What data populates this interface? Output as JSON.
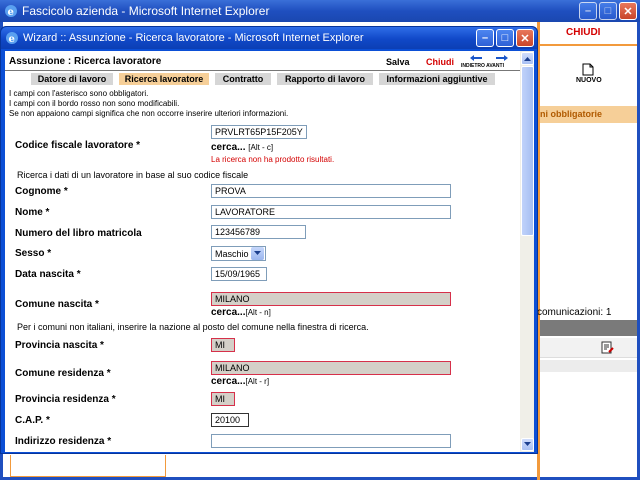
{
  "background_window": {
    "title": "Fascicolo azienda - Microsoft Internet Explorer",
    "chiudi": "CHIUDI",
    "nuovo": "NUOVO",
    "campi_obbligatorie": "ni obbligatorie",
    "comunicazioni": "comunicazioni: 1"
  },
  "popup": {
    "title": "Wizard :: Assunzione - Ricerca lavoratore - Microsoft Internet Explorer",
    "header_title": "Assunzione : Ricerca lavoratore",
    "salva": "Salva",
    "chiudi": "Chiudi",
    "nav_label": "INDIETRO AVANTI"
  },
  "tabs": [
    {
      "label": "Datore di lavoro",
      "active": false
    },
    {
      "label": "Ricerca lavoratore",
      "active": true
    },
    {
      "label": "Contratto",
      "active": false
    },
    {
      "label": "Rapporto di lavoro",
      "active": false
    },
    {
      "label": "Informazioni aggiuntive",
      "active": false
    }
  ],
  "notes": [
    "I campi con l'asterisco sono obbligatori.",
    "I campi con il bordo rosso non sono modificabili.",
    "Se non appaiono campi significa che non occorre inserire ulteriori informazioni."
  ],
  "form": {
    "codice_fiscale": {
      "label": "Codice fiscale lavoratore *",
      "value": "PRVLRT65P15F205Y",
      "cerca": "cerca...",
      "shortcut": "[Alt - c]",
      "error": "La ricerca non ha prodotto risultati."
    },
    "ricerca_info": "Ricerca i dati di un lavoratore in base al suo codice fiscale",
    "cognome": {
      "label": "Cognome *",
      "value": "PROVA"
    },
    "nome": {
      "label": "Nome *",
      "value": "LAVORATORE"
    },
    "matricola": {
      "label": "Numero del libro matricola",
      "value": "123456789"
    },
    "sesso": {
      "label": "Sesso *",
      "value": "Maschio"
    },
    "data_nascita": {
      "label": "Data nascita *",
      "value": "15/09/1965"
    },
    "comune_nascita": {
      "label": "Comune nascita *",
      "value": "MILANO",
      "cerca": "cerca...",
      "shortcut": "[Alt - n]"
    },
    "comuni_info": "Per i comuni non italiani, inserire la nazione al posto del comune nella finestra di ricerca.",
    "provincia_nascita": {
      "label": "Provincia nascita *",
      "value": "MI"
    },
    "comune_residenza": {
      "label": "Comune residenza *",
      "value": "MILANO",
      "cerca": "cerca...",
      "shortcut": "[Alt - r]"
    },
    "provincia_residenza": {
      "label": "Provincia residenza *",
      "value": "MI"
    },
    "cap": {
      "label": "C.A.P. *",
      "value": "20100"
    },
    "indirizzo": {
      "label": "Indirizzo residenza *",
      "value": ""
    }
  },
  "colors": {
    "title_blue": "#1048c8",
    "accent_orange": "#f29a3c",
    "tab_active": "#f6cf98",
    "error_red": "#d40000"
  }
}
